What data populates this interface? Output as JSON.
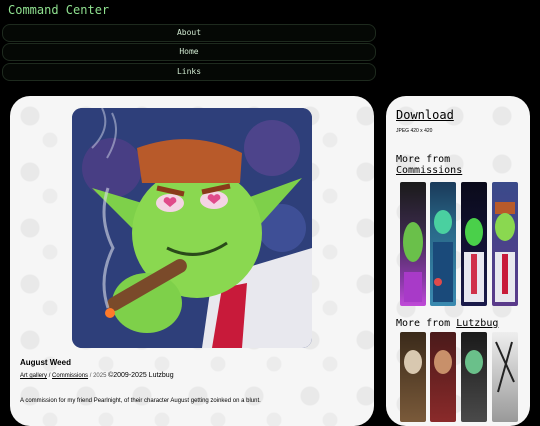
{
  "site": {
    "title": "Command Center"
  },
  "nav": {
    "items": [
      "About",
      "Home",
      "Links"
    ]
  },
  "artwork": {
    "title": "August Weed",
    "breadcrumb": {
      "gallery": "Art gallery",
      "separator": "/",
      "category": "Commissions",
      "year": "2025"
    },
    "copyright": "©2009-2025 Lutzbug",
    "description": "A commission for my friend Pearlnight, of their character August getting zoinked on a blunt."
  },
  "sidebar": {
    "download_label": "Download",
    "dimensions": "JPEG 420 x 420",
    "more_prefix": "More from",
    "more_commissions_link": "Commissions",
    "more_artist_link": "Lutzbug",
    "commission_thumbs": [
      "commission-thumb-1",
      "commission-thumb-2",
      "commission-thumb-3",
      "commission-thumb-4"
    ],
    "artist_thumbs": [
      "lutzbug-thumb-1",
      "lutzbug-thumb-2",
      "lutzbug-thumb-3",
      "lutzbug-thumb-4"
    ]
  },
  "colors": {
    "title_green": "#8fe08f",
    "card_bg": "#f6f6f6",
    "page_bg": "#000000"
  }
}
